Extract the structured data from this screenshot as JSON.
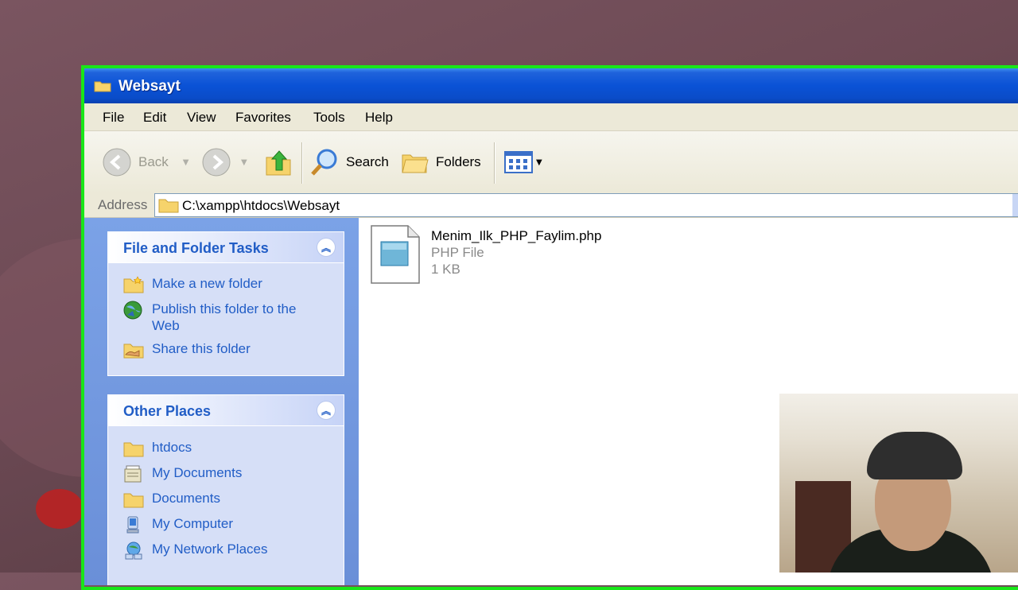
{
  "window": {
    "title": "Websayt"
  },
  "menu": [
    "File",
    "Edit",
    "View",
    "Favorites",
    "Tools",
    "Help"
  ],
  "toolbar": {
    "back_label": "Back",
    "search_label": "Search",
    "folders_label": "Folders"
  },
  "address": {
    "label": "Address",
    "path": "C:\\xampp\\htdocs\\Websayt"
  },
  "tasks_panel": {
    "title": "File and Folder Tasks",
    "items": [
      "Make a new folder",
      "Publish this folder to the Web",
      "Share this folder"
    ]
  },
  "places_panel": {
    "title": "Other Places",
    "items": [
      "htdocs",
      "My Documents",
      "Documents",
      "My Computer",
      "My Network Places"
    ]
  },
  "files": [
    {
      "name": "Menim_Ilk_PHP_Faylim.php",
      "type": "PHP File",
      "size": "1 KB"
    }
  ],
  "colors": {
    "titlebar": "#0a52d6",
    "accent_green": "#19e619",
    "task_link": "#215dc6"
  }
}
